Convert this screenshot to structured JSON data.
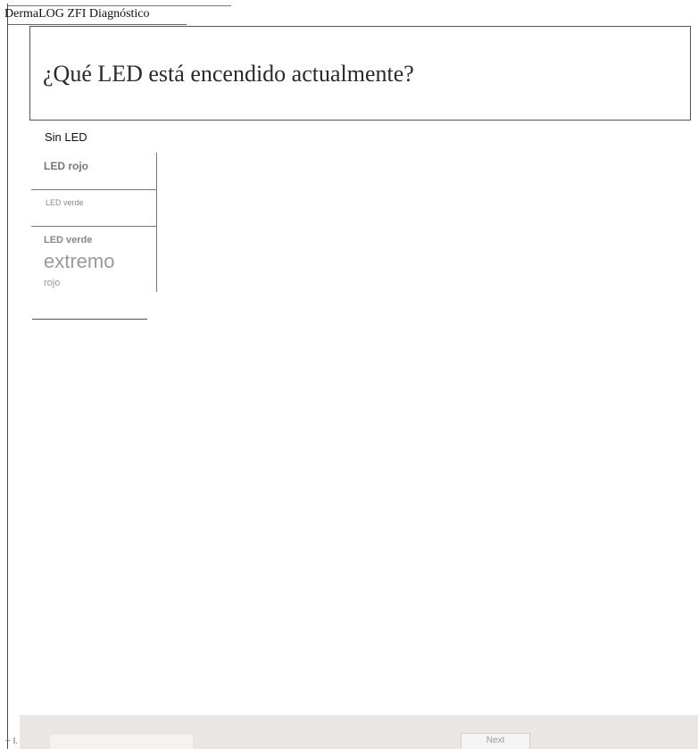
{
  "window": {
    "title": "DermaLOG ZFI Diagnóstico"
  },
  "question": {
    "text": "¿Qué LED está encendido actualmente?"
  },
  "options": [
    {
      "label": "Sin LED"
    },
    {
      "label": "LED rojo"
    },
    {
      "label": "LED verde"
    },
    {
      "label_line1": "LED verde",
      "label_line2": "extremo",
      "label_line3": "rojo"
    }
  ],
  "footer": {
    "status_text": "~ I.",
    "next_label": "Next"
  },
  "colors": {
    "background": "#ffffff",
    "footer_bar": "#e9e6e3",
    "muted_option_text": "#888888"
  }
}
